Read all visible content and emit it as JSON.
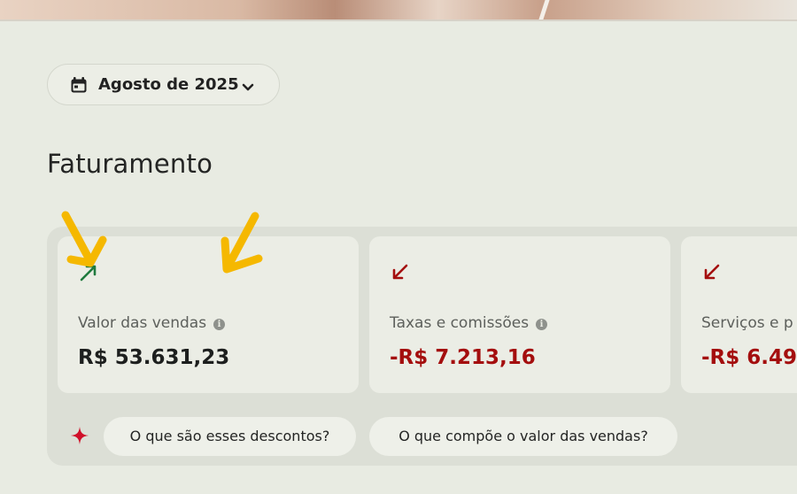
{
  "month_selector": {
    "label": "Agosto de 2025",
    "icon": "calendar-icon",
    "chevron": "chevron-down-icon"
  },
  "section": {
    "title": "Faturamento"
  },
  "cards": [
    {
      "title": "Valor das vendas",
      "value": "R$ 53.631,23",
      "trend": "up",
      "trend_color": "#1f7a3e",
      "value_color": "#1d1f1e"
    },
    {
      "title": "Taxas e comissões",
      "value": "-R$ 7.213,16",
      "trend": "down",
      "trend_color": "#a40e0e",
      "value_color": "#a40e0e"
    },
    {
      "title": "Serviços e p",
      "value": "-R$ 6.49",
      "trend": "down",
      "trend_color": "#a40e0e",
      "value_color": "#a40e0e"
    }
  ],
  "help": {
    "icon": "sparkle-icon",
    "icon_color": "#d0102a",
    "chips": [
      "O que são esses descontos?",
      "O que compõe o valor das vendas?"
    ]
  },
  "annotation_color": "#f5b800"
}
